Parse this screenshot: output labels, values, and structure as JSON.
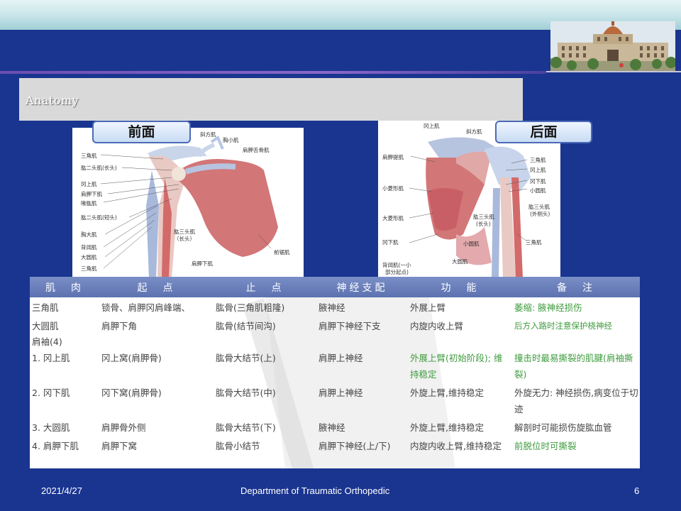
{
  "title": "Anatomy",
  "front_badge": "前面",
  "back_badge": "后面",
  "front_labels": [
    "斜方肌",
    "胸小肌",
    "肩胛舌骨肌",
    "三角肌",
    "肱二头肌(长头)",
    "冈上肌",
    "肩胛下肌",
    "喙肱肌",
    "肱二头肌(短头)",
    "胸大肌",
    "背阔肌",
    "大圆肌",
    "三角肌",
    "肱三头肌",
    "（长头）",
    "肩胛下肌",
    "前锯肌"
  ],
  "back_labels": [
    "冈上肌",
    "斜方肌",
    "肩胛提肌",
    "三角肌",
    "冈上肌",
    "冈下肌",
    "小圆肌",
    "小菱形肌",
    "大菱形肌",
    "肱三头肌",
    "(外侧头)",
    "肱三头肌",
    "(长头)",
    "冈下肌",
    "小圆肌",
    "三角肌",
    "大圆肌",
    "背阔肌(一小",
    "部分起点)"
  ],
  "table": {
    "headers": [
      "肌　肉",
      "起　点",
      "止　点",
      "神经支配",
      "功　能",
      "备　注"
    ],
    "rows": [
      [
        "三角肌",
        "锁骨、肩胛冈肩峰端、",
        "肱骨(三角肌粗隆)",
        "腋神经",
        "外展上臂",
        "萎缩: 腋神经损伤"
      ],
      [
        "大圆肌",
        "肩胛下角",
        "肱骨(结节间沟)",
        "肩胛下神经下支",
        "内旋内收上臂",
        "后方入路时注意保护桡神经"
      ],
      [
        "肩袖(4)",
        "",
        "",
        "",
        "",
        ""
      ],
      [
        "1. 冈上肌",
        "冈上窝(肩胛骨)",
        "肱骨大结节(上)",
        "肩胛上神经",
        "外展上臂(初始阶段); 维持稳定",
        "撞击时最易撕裂的肌腱(肩袖撕裂)"
      ],
      [
        "2. 冈下肌",
        "冈下窝(肩胛骨)",
        "肱骨大结节(中)",
        "肩胛上神经",
        "外旋上臂,维持稳定",
        "外旋无力: 神经损伤,病变位于切迹"
      ],
      [
        "3. 大圆肌",
        "肩胛骨外侧",
        "肱骨大结节(下)",
        "腋神经",
        "外旋上臂,维持稳定",
        "解剖时可能损伤旋肱血管"
      ],
      [
        "4. 肩胛下肌",
        "肩胛下窝",
        "肱骨小结节",
        "肩胛下神经(上/下)",
        "内旋内收上臂,维持稳定",
        "前脱位时可撕裂"
      ]
    ]
  },
  "footer": {
    "date": "2021/4/27",
    "department": "Department of Traumatic Orthopedic",
    "page": "6"
  },
  "colors": {
    "background": "#1a3590",
    "table_header": "#6b80bc",
    "green_text": "#3e9b3e"
  }
}
